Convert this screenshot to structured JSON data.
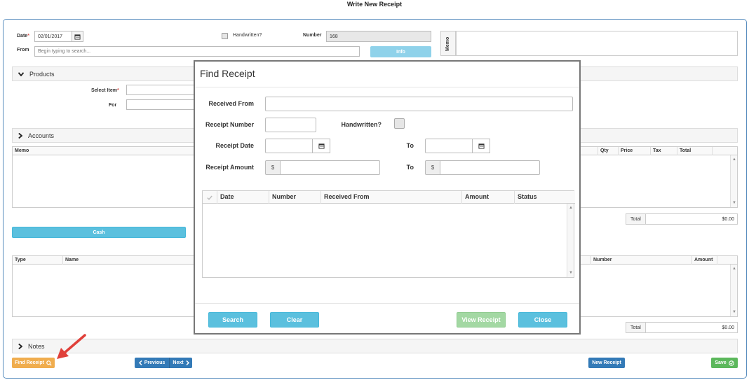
{
  "page": {
    "title": "Write New Receipt"
  },
  "header": {
    "date_label": "Date",
    "date_value": "02/01/2017",
    "handwritten_label": "Handwritten?",
    "number_label": "Number",
    "number_value": "168",
    "from_label": "From",
    "from_placeholder": "Begin typing to search...",
    "info_label": "Info",
    "memo_label": "Memo"
  },
  "products": {
    "title": "Products",
    "select_item_label": "Select Item",
    "for_label": "For"
  },
  "accounts": {
    "title": "Accounts",
    "columns": [
      "Memo",
      "Qty",
      "Price",
      "Tax",
      "Total"
    ],
    "total_label": "Total",
    "total_value": "$0.00"
  },
  "payments": {
    "cash_label": "Cash",
    "columns": [
      "Type",
      "Name",
      "Number",
      "Amount"
    ],
    "total_label": "Total",
    "total_value": "$0.00"
  },
  "notes": {
    "title": "Notes"
  },
  "footer": {
    "find_receipt": "Find Receipt",
    "previous": "Previous",
    "next": "Next",
    "new_receipt": "New Receipt",
    "save": "Save"
  },
  "modal": {
    "title": "Find Receipt",
    "received_from_label": "Received From",
    "receipt_number_label": "Receipt Number",
    "handwritten_label": "Handwritten?",
    "receipt_date_label": "Receipt Date",
    "to_label": "To",
    "receipt_amount_label": "Receipt Amount",
    "currency_symbol": "$",
    "columns": [
      "Date",
      "Number",
      "Received From",
      "Amount",
      "Status"
    ],
    "buttons": {
      "search": "Search",
      "clear": "Clear",
      "view_receipt": "View Receipt",
      "close": "Close"
    }
  },
  "colors": {
    "accent_blue": "#337ab7",
    "info_cyan": "#5bc0de",
    "warning_orange": "#f0ad4e",
    "success_green": "#5cb85c",
    "arrow_red": "#e0403a"
  }
}
